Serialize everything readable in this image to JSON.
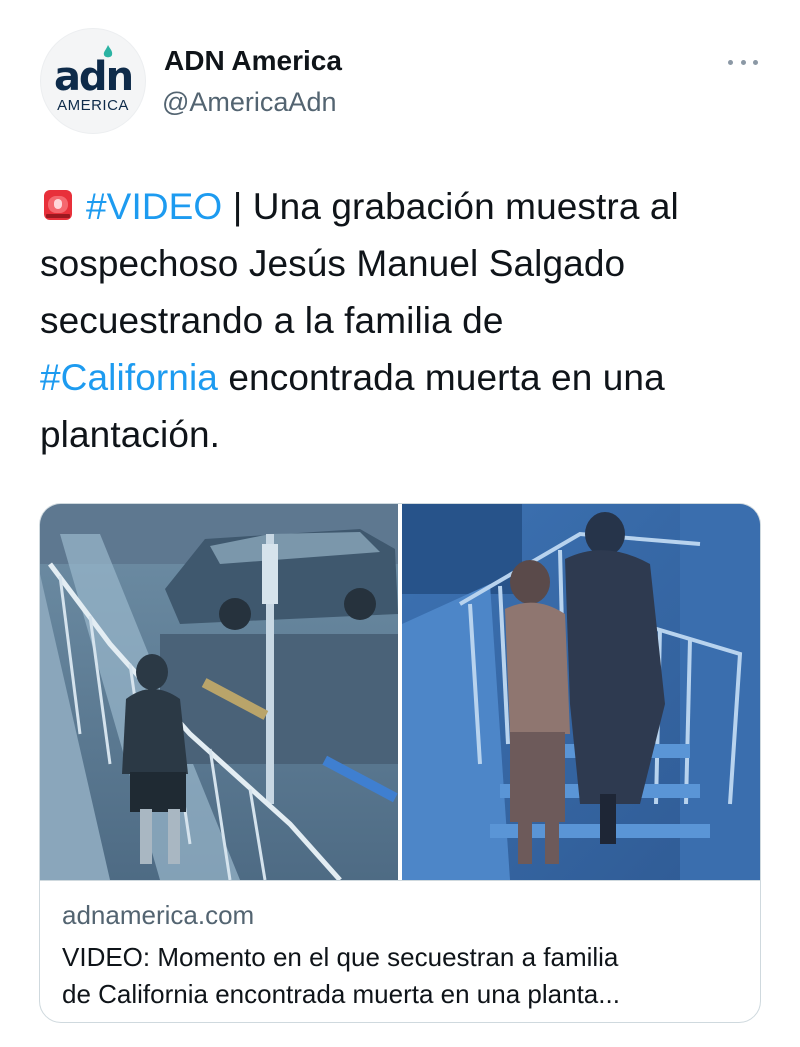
{
  "tweet": {
    "author": {
      "display_name": "ADN America",
      "handle": "@AmericaAdn",
      "avatar_logo_main": "adn",
      "avatar_logo_sub": "AMERICA"
    },
    "more_icon": "ellipsis-icon",
    "emoji_icon": "police-siren-emoji",
    "text": {
      "hashtag_video": "#VIDEO",
      "line1_rest": " | Una grabación muestra al",
      "line2": "sospechoso Jesús Manuel Salgado",
      "line3": "secuestrando a la familia de",
      "hashtag_california": "#California",
      "line4_rest": " encontrada muerta en una",
      "line5": "plantación."
    },
    "link_card": {
      "domain": "adnamerica.com",
      "title_line1": "VIDEO: Momento en el que secuestran a familia",
      "title_line2": "de California encontrada muerta en una planta..."
    }
  },
  "colors": {
    "link_blue": "#1d9bf0",
    "text_primary": "#0f1419",
    "text_secondary": "#536471",
    "border": "#cfd9de"
  }
}
